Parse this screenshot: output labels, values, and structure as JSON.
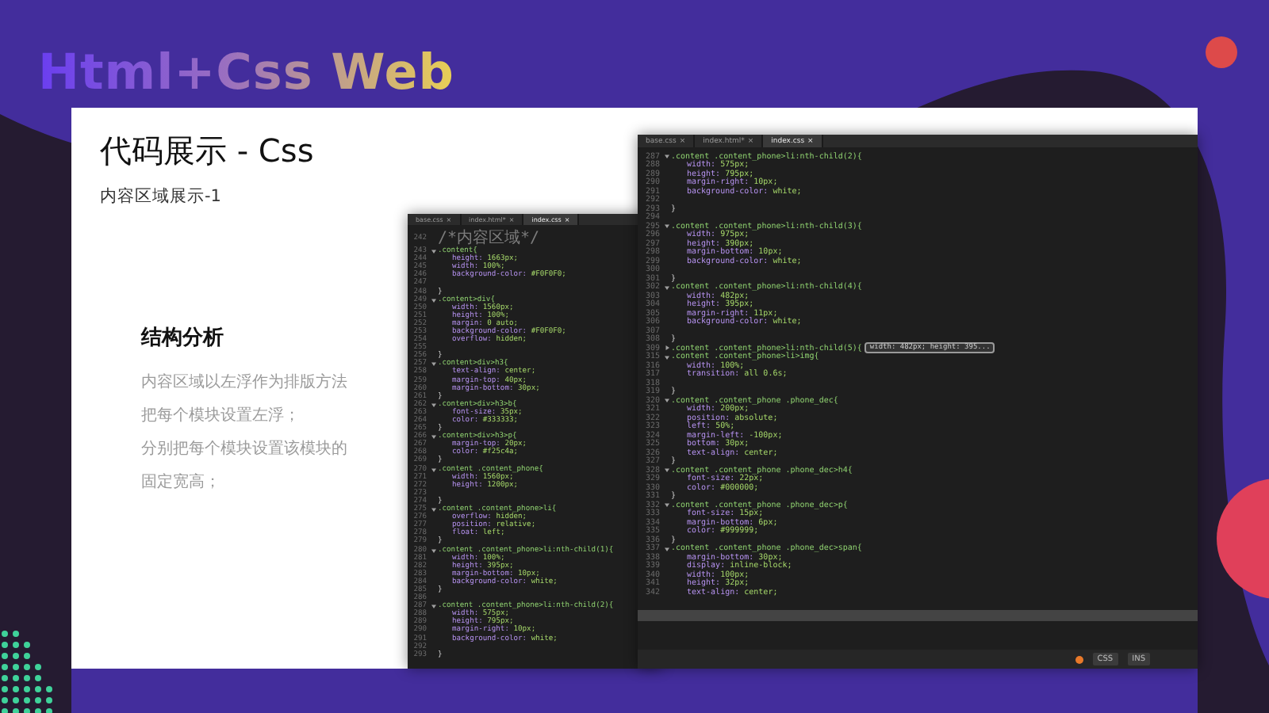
{
  "header": {
    "title": "Html+Css Web"
  },
  "card": {
    "title": "代码展示 - Css",
    "subtitle": "内容区域展示-1",
    "section": {
      "heading": "结构分析",
      "lines": [
        "内容区域以左浮作为排版方法",
        "把每个模块设置左浮；",
        "分别把每个模块设置该模块的",
        "固定宽高；"
      ]
    }
  },
  "editors": [
    {
      "tabs": [
        {
          "label": "base.css",
          "close": "×",
          "selected": false
        },
        {
          "label": "index.html*",
          "close": "×",
          "selected": false
        },
        {
          "label": "index.css",
          "close": "×",
          "selected": true
        }
      ],
      "lines": [
        {
          "n": "242",
          "kind": "comment",
          "text": "/*内容区域*/"
        },
        {
          "n": "243",
          "kind": "selector",
          "text": ".content{",
          "folded": false
        },
        {
          "n": "244",
          "kind": "prop",
          "prop": "height:",
          "value": "1663px;"
        },
        {
          "n": "245",
          "kind": "prop",
          "prop": "width:",
          "value": "100%;"
        },
        {
          "n": "246",
          "kind": "prop",
          "prop": "background-color:",
          "value": "#F0F0F0;"
        },
        {
          "n": "247",
          "kind": "blank"
        },
        {
          "n": "248",
          "kind": "brace",
          "text": "}"
        },
        {
          "n": "249",
          "kind": "selector",
          "text": ".content>div{",
          "folded": false
        },
        {
          "n": "250",
          "kind": "prop",
          "prop": "width:",
          "value": "1560px;"
        },
        {
          "n": "251",
          "kind": "prop",
          "prop": "height:",
          "value": "100%;"
        },
        {
          "n": "252",
          "kind": "prop",
          "prop": "margin:",
          "value": "0 auto;"
        },
        {
          "n": "253",
          "kind": "prop",
          "prop": "background-color:",
          "value": "#F0F0F0;"
        },
        {
          "n": "254",
          "kind": "prop",
          "prop": "overflow:",
          "value": "hidden;"
        },
        {
          "n": "255",
          "kind": "blank"
        },
        {
          "n": "256",
          "kind": "brace",
          "text": "}"
        },
        {
          "n": "257",
          "kind": "selector",
          "text": ".content>div>h3{",
          "folded": false
        },
        {
          "n": "258",
          "kind": "prop",
          "prop": "text-align:",
          "value": "center;"
        },
        {
          "n": "259",
          "kind": "prop",
          "prop": "margin-top:",
          "value": "40px;"
        },
        {
          "n": "260",
          "kind": "prop",
          "prop": "margin-bottom:",
          "value": "30px;"
        },
        {
          "n": "261",
          "kind": "brace",
          "text": "}"
        },
        {
          "n": "262",
          "kind": "selector",
          "text": ".content>div>h3>b{",
          "folded": false
        },
        {
          "n": "263",
          "kind": "prop",
          "prop": "font-size:",
          "value": "35px;"
        },
        {
          "n": "264",
          "kind": "prop",
          "prop": "color:",
          "value": "#333333;"
        },
        {
          "n": "265",
          "kind": "brace",
          "text": "}"
        },
        {
          "n": "266",
          "kind": "selector",
          "text": ".content>div>h3>p{",
          "folded": false
        },
        {
          "n": "267",
          "kind": "prop",
          "prop": "margin-top:",
          "value": "20px;"
        },
        {
          "n": "268",
          "kind": "prop",
          "prop": "color:",
          "value": "#f25c4a;"
        },
        {
          "n": "269",
          "kind": "brace",
          "text": "}"
        },
        {
          "n": "270",
          "kind": "selector",
          "text": ".content .content_phone{",
          "folded": false
        },
        {
          "n": "271",
          "kind": "prop",
          "prop": "width:",
          "value": "1560px;"
        },
        {
          "n": "272",
          "kind": "prop",
          "prop": "height:",
          "value": "1200px;"
        },
        {
          "n": "273",
          "kind": "blank"
        },
        {
          "n": "274",
          "kind": "brace",
          "text": "}"
        },
        {
          "n": "275",
          "kind": "selector",
          "text": ".content .content_phone>li{",
          "folded": false
        },
        {
          "n": "276",
          "kind": "prop",
          "prop": "overflow:",
          "value": "hidden;"
        },
        {
          "n": "277",
          "kind": "prop",
          "prop": "position:",
          "value": "relative;"
        },
        {
          "n": "278",
          "kind": "prop",
          "prop": "float:",
          "value": "left;"
        },
        {
          "n": "279",
          "kind": "brace",
          "text": "}"
        },
        {
          "n": "280",
          "kind": "selector",
          "text": ".content .content_phone>li:nth-child(1){",
          "folded": false
        },
        {
          "n": "281",
          "kind": "prop",
          "prop": "width:",
          "value": "100%;"
        },
        {
          "n": "282",
          "kind": "prop",
          "prop": "height:",
          "value": "395px;"
        },
        {
          "n": "283",
          "kind": "prop",
          "prop": "margin-bottom:",
          "value": "10px;"
        },
        {
          "n": "284",
          "kind": "prop",
          "prop": "background-color:",
          "value": "white;"
        },
        {
          "n": "285",
          "kind": "brace",
          "text": "}"
        },
        {
          "n": "286",
          "kind": "blank"
        },
        {
          "n": "287",
          "kind": "selector",
          "text": ".content .content_phone>li:nth-child(2){",
          "folded": false
        },
        {
          "n": "288",
          "kind": "prop",
          "prop": "width:",
          "value": "575px;"
        },
        {
          "n": "289",
          "kind": "prop",
          "prop": "height:",
          "value": "795px;"
        },
        {
          "n": "290",
          "kind": "prop",
          "prop": "margin-right:",
          "value": "10px;"
        },
        {
          "n": "291",
          "kind": "prop",
          "prop": "background-color:",
          "value": "white;"
        },
        {
          "n": "292",
          "kind": "blank"
        },
        {
          "n": "293",
          "kind": "brace",
          "text": "}"
        }
      ]
    },
    {
      "tabs": [
        {
          "label": "base.css",
          "close": "×",
          "selected": false
        },
        {
          "label": "index.html*",
          "close": "×",
          "selected": false
        },
        {
          "label": "index.css",
          "close": "×",
          "selected": true
        }
      ],
      "lines": [
        {
          "n": "287",
          "kind": "selector",
          "text": ".content .content_phone>li:nth-child(2){",
          "folded": false
        },
        {
          "n": "288",
          "kind": "prop",
          "prop": "width:",
          "value": "575px;"
        },
        {
          "n": "289",
          "kind": "prop",
          "prop": "height:",
          "value": "795px;"
        },
        {
          "n": "290",
          "kind": "prop",
          "prop": "margin-right:",
          "value": "10px;"
        },
        {
          "n": "291",
          "kind": "prop",
          "prop": "background-color:",
          "value": "white;"
        },
        {
          "n": "292",
          "kind": "blank"
        },
        {
          "n": "293",
          "kind": "brace",
          "text": "}"
        },
        {
          "n": "294",
          "kind": "blank"
        },
        {
          "n": "295",
          "kind": "selector",
          "text": ".content .content_phone>li:nth-child(3){",
          "folded": false
        },
        {
          "n": "296",
          "kind": "prop",
          "prop": "width:",
          "value": "975px;"
        },
        {
          "n": "297",
          "kind": "prop",
          "prop": "height:",
          "value": "390px;"
        },
        {
          "n": "298",
          "kind": "prop",
          "prop": "margin-bottom:",
          "value": "10px;"
        },
        {
          "n": "299",
          "kind": "prop",
          "prop": "background-color:",
          "value": "white;"
        },
        {
          "n": "300",
          "kind": "blank"
        },
        {
          "n": "301",
          "kind": "brace",
          "text": "}"
        },
        {
          "n": "302",
          "kind": "selector",
          "text": ".content .content_phone>li:nth-child(4){",
          "folded": false
        },
        {
          "n": "303",
          "kind": "prop",
          "prop": "width:",
          "value": "482px;"
        },
        {
          "n": "304",
          "kind": "prop",
          "prop": "height:",
          "value": "395px;"
        },
        {
          "n": "305",
          "kind": "prop",
          "prop": "margin-right:",
          "value": "11px;"
        },
        {
          "n": "306",
          "kind": "prop",
          "prop": "background-color:",
          "value": "white;"
        },
        {
          "n": "307",
          "kind": "blank"
        },
        {
          "n": "308",
          "kind": "brace",
          "text": "}"
        },
        {
          "n": "309",
          "kind": "selector",
          "text": ".content .content_phone>li:nth-child(5){",
          "folded": true,
          "hint": "width: 482px; height: 395..."
        },
        {
          "n": "315",
          "kind": "selector",
          "text": ".content .content_phone>li>img{",
          "folded": false
        },
        {
          "n": "316",
          "kind": "prop",
          "prop": "width:",
          "value": "100%;"
        },
        {
          "n": "317",
          "kind": "prop",
          "prop": "transition:",
          "value": "all 0.6s;"
        },
        {
          "n": "318",
          "kind": "blank"
        },
        {
          "n": "319",
          "kind": "brace",
          "text": "}"
        },
        {
          "n": "320",
          "kind": "selector",
          "text": ".content .content_phone .phone_dec{",
          "folded": false
        },
        {
          "n": "321",
          "kind": "prop",
          "prop": "width:",
          "value": "200px;"
        },
        {
          "n": "322",
          "kind": "prop",
          "prop": "position:",
          "value": "absolute;"
        },
        {
          "n": "323",
          "kind": "prop",
          "prop": "left:",
          "value": "50%;"
        },
        {
          "n": "324",
          "kind": "prop",
          "prop": "margin-left:",
          "value": "-100px;"
        },
        {
          "n": "325",
          "kind": "prop",
          "prop": "bottom:",
          "value": "30px;"
        },
        {
          "n": "326",
          "kind": "prop",
          "prop": "text-align:",
          "value": "center;"
        },
        {
          "n": "327",
          "kind": "brace",
          "text": "}"
        },
        {
          "n": "328",
          "kind": "selector",
          "text": ".content .content_phone .phone_dec>h4{",
          "folded": false
        },
        {
          "n": "329",
          "kind": "prop",
          "prop": "font-size:",
          "value": "22px;"
        },
        {
          "n": "330",
          "kind": "prop",
          "prop": "color:",
          "value": "#000000;"
        },
        {
          "n": "331",
          "kind": "brace",
          "text": "}"
        },
        {
          "n": "332",
          "kind": "selector",
          "text": ".content .content_phone .phone_dec>p{",
          "folded": false
        },
        {
          "n": "333",
          "kind": "prop",
          "prop": "font-size:",
          "value": "15px;"
        },
        {
          "n": "334",
          "kind": "prop",
          "prop": "margin-bottom:",
          "value": "6px;"
        },
        {
          "n": "335",
          "kind": "prop",
          "prop": "color:",
          "value": "#999999;"
        },
        {
          "n": "336",
          "kind": "brace",
          "text": "}"
        },
        {
          "n": "337",
          "kind": "selector",
          "text": ".content .content_phone .phone_dec>span{",
          "folded": false
        },
        {
          "n": "338",
          "kind": "prop",
          "prop": "margin-bottom:",
          "value": "30px;"
        },
        {
          "n": "339",
          "kind": "prop",
          "prop": "display:",
          "value": "inline-block;"
        },
        {
          "n": "340",
          "kind": "prop",
          "prop": "width:",
          "value": "100px;"
        },
        {
          "n": "341",
          "kind": "prop",
          "prop": "height:",
          "value": "32px;"
        },
        {
          "n": "342",
          "kind": "prop",
          "prop": "text-align:",
          "value": "center;"
        }
      ],
      "status": [
        "CSS",
        "INS"
      ]
    }
  ]
}
